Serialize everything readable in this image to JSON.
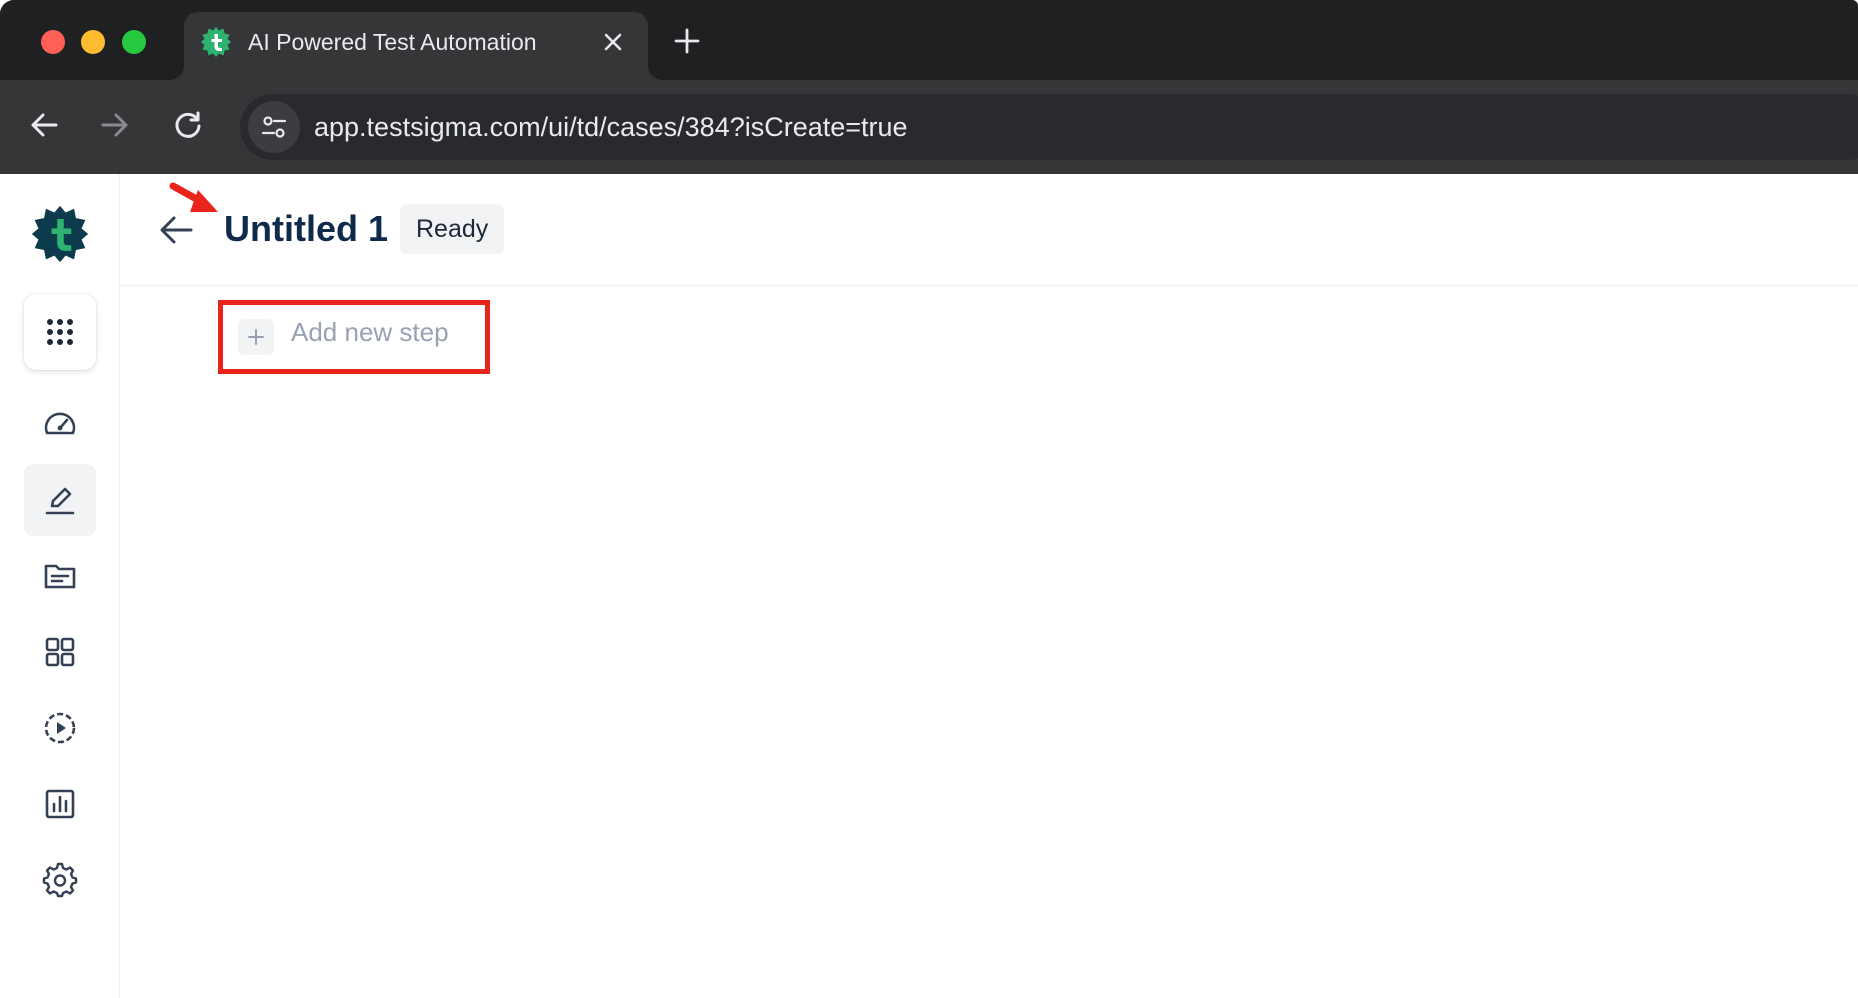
{
  "browser": {
    "tab": {
      "title": "AI Powered Test Automation",
      "favicon": "testsigma-logo-icon"
    },
    "address_bar": {
      "url": "app.testsigma.com/ui/td/cases/384?isCreate=true"
    },
    "icons": [
      "back-icon",
      "forward-icon",
      "reload-icon",
      "site-info-icon",
      "close-icon",
      "plus-icon"
    ]
  },
  "sidebar": {
    "logo": "testsigma-logo-icon",
    "items": [
      {
        "name": "apps-grid-icon",
        "active": false
      },
      {
        "name": "dashboard-gauge-icon",
        "active": false
      },
      {
        "name": "edit-pencil-icon",
        "active": true
      },
      {
        "name": "folder-icon",
        "active": false
      },
      {
        "name": "modules-grid-icon",
        "active": false
      },
      {
        "name": "run-play-icon",
        "active": false
      },
      {
        "name": "reports-chart-icon",
        "active": false
      },
      {
        "name": "settings-gear-icon",
        "active": false
      }
    ]
  },
  "header": {
    "title": "Untitled 1",
    "status": "Ready"
  },
  "editor": {
    "add_step_label": "Add new step"
  },
  "colors": {
    "brand_dark": "#0b3b4c",
    "brand_green": "#2db36f",
    "title_text": "#0f2a4a",
    "highlight_red": "#e8241b",
    "placeholder_text": "#98a2b3"
  }
}
